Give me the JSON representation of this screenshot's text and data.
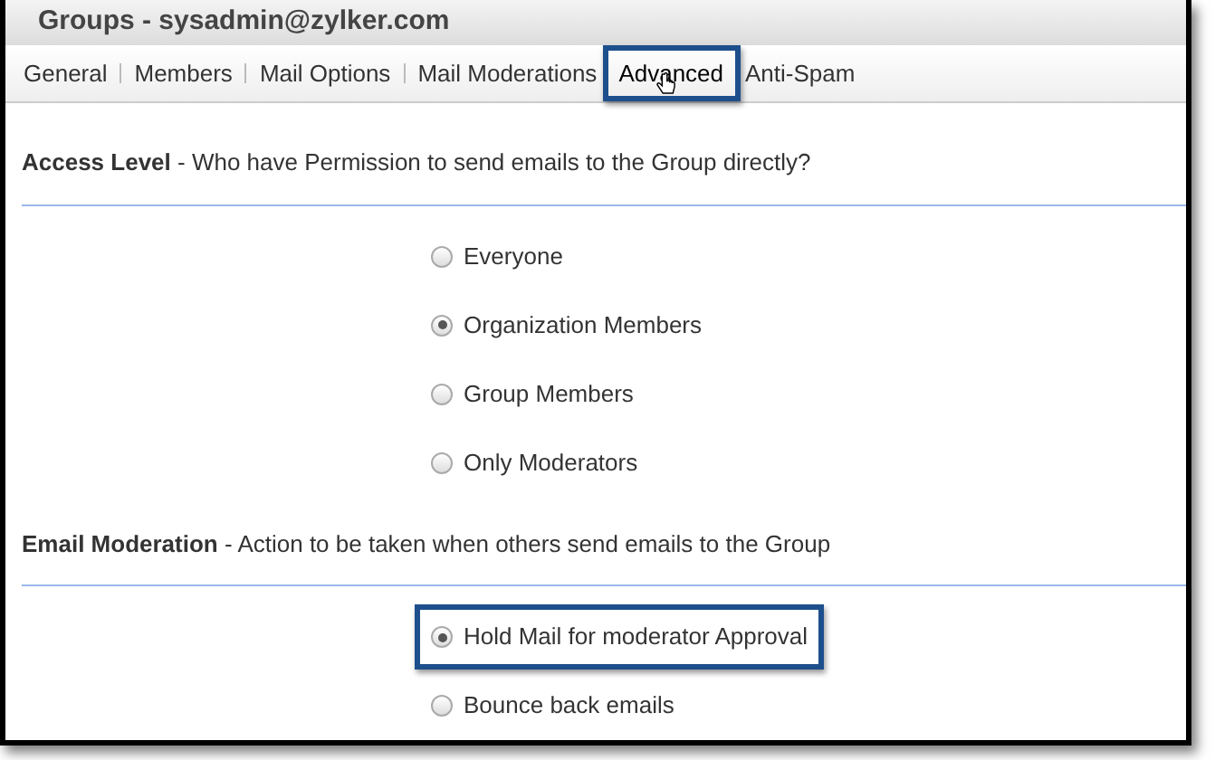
{
  "window": {
    "title": "Groups - sysadmin@zylker.com"
  },
  "tabs": [
    {
      "label": "General",
      "selected": false,
      "highlighted": false
    },
    {
      "label": "Members",
      "selected": false,
      "highlighted": false
    },
    {
      "label": "Mail Options",
      "selected": false,
      "highlighted": false
    },
    {
      "label": "Mail Moderations",
      "selected": false,
      "highlighted": false
    },
    {
      "label": "Advanced",
      "selected": true,
      "highlighted": true
    },
    {
      "label": "Anti-Spam",
      "selected": false,
      "highlighted": false
    }
  ],
  "sections": [
    {
      "heading": "Access Level",
      "description": " - Who have Permission to send emails to the Group directly?",
      "options": [
        {
          "label": "Everyone",
          "selected": false,
          "highlighted": false
        },
        {
          "label": "Organization Members",
          "selected": true,
          "highlighted": false
        },
        {
          "label": "Group Members",
          "selected": false,
          "highlighted": false
        },
        {
          "label": "Only Moderators",
          "selected": false,
          "highlighted": false
        }
      ]
    },
    {
      "heading": "Email Moderation",
      "description": " - Action to be taken when others send emails to the Group",
      "options": [
        {
          "label": "Hold Mail for moderator Approval",
          "selected": true,
          "highlighted": true
        },
        {
          "label": "Bounce back emails",
          "selected": false,
          "highlighted": false
        }
      ]
    }
  ]
}
